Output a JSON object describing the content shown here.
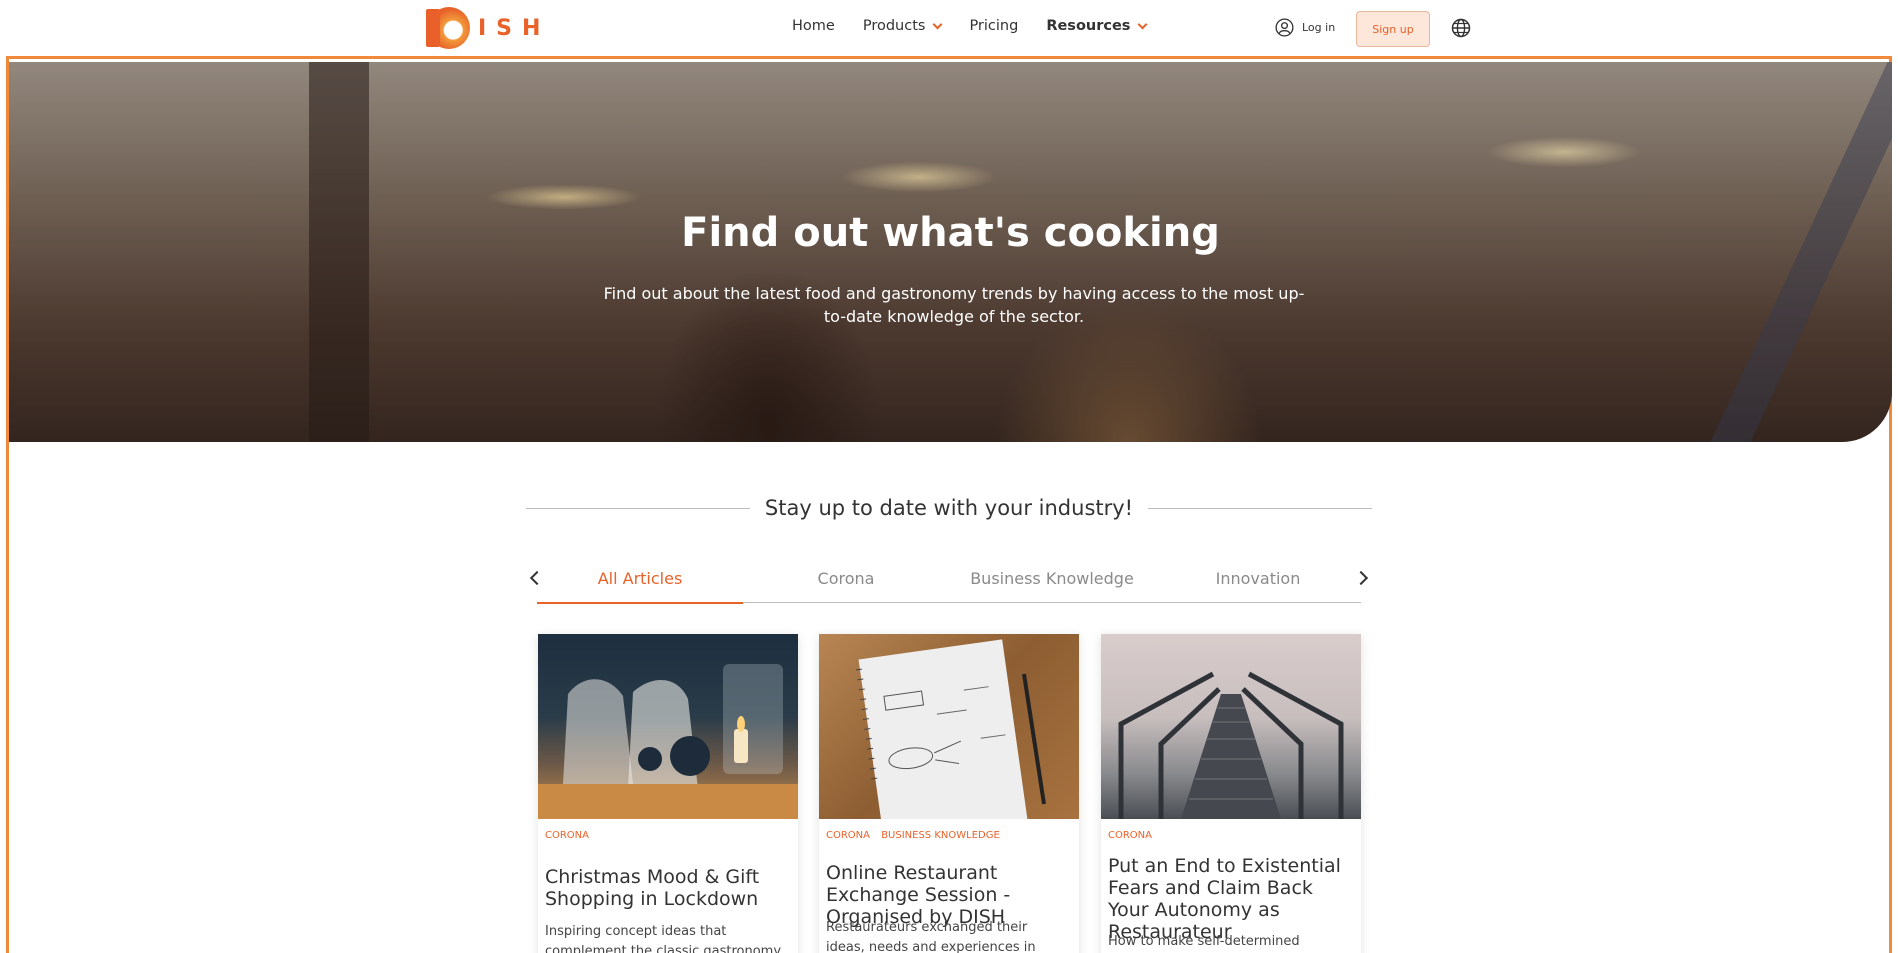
{
  "header": {
    "logo_text": "ISH",
    "nav": [
      {
        "label": "Home",
        "has_dropdown": false,
        "bold": false
      },
      {
        "label": "Products",
        "has_dropdown": true,
        "bold": false
      },
      {
        "label": "Pricing",
        "has_dropdown": false,
        "bold": false
      },
      {
        "label": "Resources",
        "has_dropdown": true,
        "bold": true
      }
    ],
    "login_label": "Log in",
    "signup_label": "Sign up",
    "icons": {
      "user": "user-icon",
      "globe": "globe-icon"
    }
  },
  "hero": {
    "title": "Find out what's cooking",
    "subtitle": "Find out about the latest food and gastronomy trends by having access to the most up-to-date knowledge of the sector."
  },
  "section": {
    "title": "Stay up to date with your industry!"
  },
  "tabs": {
    "items": [
      "All Articles",
      "Corona",
      "Business Knowledge",
      "Innovation"
    ],
    "active_index": 0
  },
  "articles": [
    {
      "categories": [
        "CORONA"
      ],
      "title": "Christmas Mood & Gift Shopping in Lockdown",
      "description": "Inspiring concept ideas that complement the classic gastronomy offer"
    },
    {
      "categories": [
        "CORONA",
        "BUSINESS KNOWLEDGE"
      ],
      "title": "Online Restaurant Exchange Session - Organised by DISH",
      "description": "Restaurateurs exchanged their ideas, needs and experiences in times of"
    },
    {
      "categories": [
        "CORONA"
      ],
      "title": "Put an End to Existential Fears and Claim Back Your Autonomy as Restaurateur",
      "description": "How to make self-determined decisions"
    }
  ],
  "colors": {
    "accent": "#e8622a",
    "frame": "#f08a3a",
    "signup_bg": "#fde6da"
  }
}
